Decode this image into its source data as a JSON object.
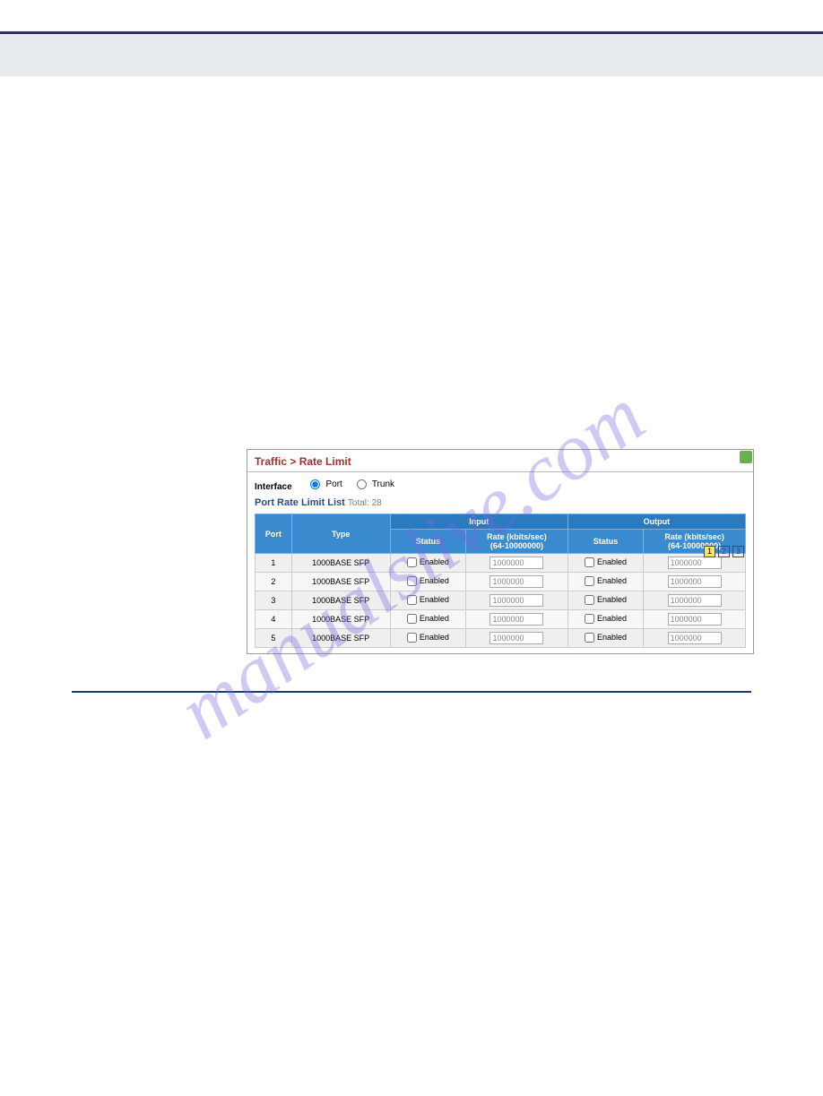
{
  "watermark": "manualslive.com",
  "panel": {
    "title": "Traffic > Rate Limit",
    "interface_label": "Interface",
    "radios": {
      "port": "Port",
      "trunk": "Trunk"
    },
    "list_title": "Port Rate Limit List",
    "total_label": "Total: 28",
    "pages": [
      "1",
      "2",
      "3"
    ],
    "headers": {
      "port": "Port",
      "type": "Type",
      "input": "Input",
      "output": "Output",
      "status": "Status",
      "rate": "Rate (kbits/sec)\n(64-10000000)",
      "enabled": "Enabled"
    },
    "rows": [
      {
        "port": "1",
        "type": "1000BASE SFP",
        "in_checked": false,
        "in_rate": "1000000",
        "out_checked": false,
        "out_rate": "1000000"
      },
      {
        "port": "2",
        "type": "1000BASE SFP",
        "in_checked": false,
        "in_rate": "1000000",
        "out_checked": false,
        "out_rate": "1000000"
      },
      {
        "port": "3",
        "type": "1000BASE SFP",
        "in_checked": false,
        "in_rate": "1000000",
        "out_checked": false,
        "out_rate": "1000000"
      },
      {
        "port": "4",
        "type": "1000BASE SFP",
        "in_checked": false,
        "in_rate": "1000000",
        "out_checked": false,
        "out_rate": "1000000"
      },
      {
        "port": "5",
        "type": "1000BASE SFP",
        "in_checked": false,
        "in_rate": "1000000",
        "out_checked": false,
        "out_rate": "1000000"
      }
    ]
  }
}
